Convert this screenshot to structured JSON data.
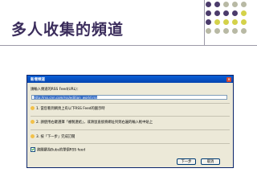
{
  "slide": {
    "title": "多人收集的頻道"
  },
  "decoration": {
    "dot_colors": [
      "#4b3b6b",
      "#b8b9a4",
      "#d4d24a"
    ]
  },
  "dialog": {
    "title": "新增頻道",
    "close_icon": "close-icon",
    "url_label": "請輸入頻道的RSS Feed(URL)：",
    "url_value": "http://rss.cnn.com/rss/edition_world.rss",
    "step1": "1. 當您看到網頁上有以下RSS Feed的圖示時",
    "step2": "2. 請使用右鍵選擇「複製連結」，或滑鼠直接將網址列到右邊的輸入框中貼上",
    "step3": "3. 按「下一步」完成訂閱",
    "checkbox_label": "將關鍵為Bubs的單個RSS feed",
    "next_button": "下一步",
    "cancel_button": "取消"
  }
}
